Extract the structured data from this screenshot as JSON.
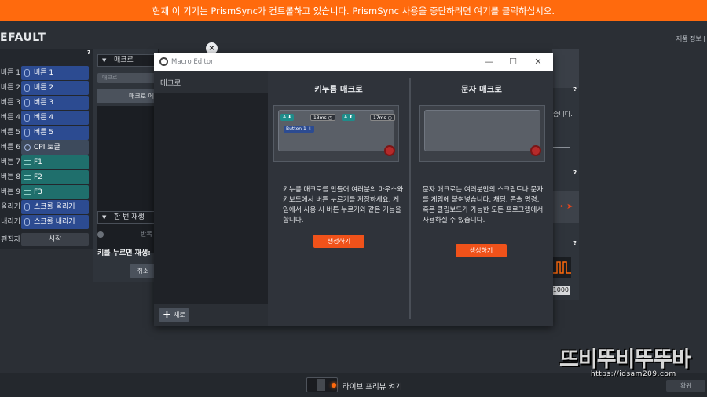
{
  "banner": {
    "text": "현재 이 기기는 PrismSync가 컨트롤하고 있습니다. PrismSync 사용을 중단하려면 여기를 클릭하십시오."
  },
  "app": {
    "title": "EFAULT",
    "product_info": "제품 정보 |"
  },
  "left_panel": {
    "help": "?",
    "rows": [
      {
        "label": "버튼 1",
        "value": "버튼 1",
        "style": "blue"
      },
      {
        "label": "버튼 2",
        "value": "버튼 2",
        "style": "blue"
      },
      {
        "label": "버튼 3",
        "value": "버튼 3",
        "style": "blue"
      },
      {
        "label": "버튼 4",
        "value": "버튼 4",
        "style": "blue"
      },
      {
        "label": "버튼 5",
        "value": "버튼 5",
        "style": "blue"
      },
      {
        "label": "버튼 6",
        "value": "CPI 토글",
        "style": "gray"
      },
      {
        "label": "버튼 7",
        "value": "F1",
        "style": "teal"
      },
      {
        "label": "버튼 8",
        "value": "F2",
        "style": "teal"
      },
      {
        "label": "버튼 9",
        "value": "F3",
        "style": "teal"
      },
      {
        "label": "올리기",
        "value": "스크롤 올리기",
        "style": "blue"
      },
      {
        "label": "내리기",
        "value": "스크롤 내리기",
        "style": "blue"
      }
    ],
    "start_label": "편집자",
    "start_button": "시작"
  },
  "macro_panel": {
    "select_value": "매크로",
    "search_placeholder": "매크로",
    "edit_button": "매크로 에",
    "play_select": "한 번 재생",
    "mode_text": "반복",
    "key_label": "키를 누르면 재생:",
    "cancel_button": "취소"
  },
  "editor": {
    "title": "Macro Editor",
    "sidebar_title": "매크로",
    "new_button": "새로",
    "key_macro": {
      "title": "키누름 매크로",
      "chips": [
        "A",
        "13ms",
        "A",
        "17ms",
        "Button 1"
      ],
      "description": "키누름 매크로를 만들어 여러분의 마우스와 키보드에서 버튼 누르기를 저장하세요. 게임에서 사용 시 버튼 누르기와 같은 기능을 합니다.",
      "create_button": "생성하기"
    },
    "text_macro": {
      "title": "문자 매크로",
      "description": "문자 매크로는 여러분만의 스크립트나 문자를 게임에 붙여넣습니다. 채팅, 콘솔 명령, 혹은 클립보드가 가능한 모든 프로그램에서 사용하실 수 있습니다.",
      "create_button": "생성하기"
    }
  },
  "right_panel": {
    "partial_text": "습니다.",
    "value": "1000"
  },
  "bottom": {
    "live_preview_label": "라이브 프리뷰 켜기",
    "confirm_button": "확귀"
  },
  "watermark": {
    "main": "뜨비뚜비뚜뚜바",
    "url": "https://idsam209.com"
  },
  "colors": {
    "banner": "#ff6a0d",
    "accent": "#f0521a",
    "button_blue": "#2c4b91",
    "button_teal": "#1f6f6c"
  }
}
